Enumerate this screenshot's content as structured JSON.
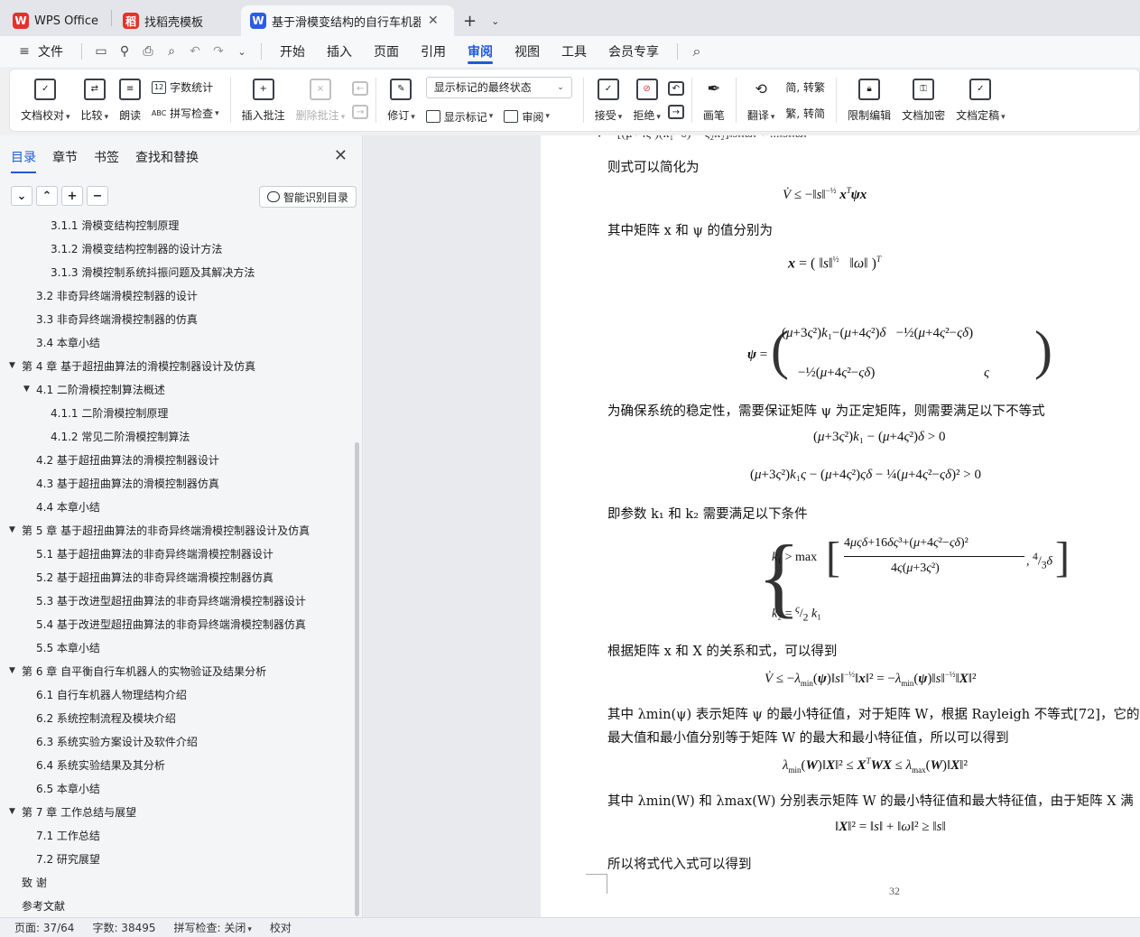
{
  "tabs": [
    {
      "label": "WPS Office",
      "logo": "W",
      "color": "#e5322d",
      "active": false
    },
    {
      "label": "找稻壳模板",
      "logo": "稻",
      "color": "#e5322d",
      "active": false
    },
    {
      "label": "基于滑模变结构的自行车机器人",
      "logo": "W",
      "color": "#2b5ce6",
      "active": true
    }
  ],
  "menu": {
    "file": "文件",
    "items": [
      "开始",
      "插入",
      "页面",
      "引用",
      "审阅",
      "视图",
      "工具",
      "会员专享"
    ],
    "active": "审阅"
  },
  "ribbon": {
    "doc_check": "文档校对",
    "compare": "比较",
    "read_aloud": "朗读",
    "word_count": "字数统计",
    "spell_check": "拼写检查",
    "insert_comment": "插入批注",
    "delete_comment": "删除批注",
    "revise": "修订",
    "markup_state": "显示标记的最终状态",
    "show_markup": "显示标记",
    "review": "审阅",
    "accept": "接受",
    "reject": "拒绝",
    "pen": "画笔",
    "translate": "翻译",
    "to_traditional": "简, 转繁",
    "to_simplified": "繁, 转简",
    "restrict_edit": "限制编辑",
    "encrypt": "文档加密",
    "finalize": "文档定稿"
  },
  "nav": {
    "tabs": [
      "目录",
      "章节",
      "书签",
      "查找和替换"
    ],
    "smart_toc": "智能识别目录",
    "toc": [
      {
        "text": "3.1.1 滑模变结构控制原理",
        "level": 3,
        "arrow": ""
      },
      {
        "text": "3.1.2  滑模变结构控制器的设计方法",
        "level": 3,
        "arrow": ""
      },
      {
        "text": "3.1.3 滑模控制系统抖振问题及其解决方法",
        "level": 3,
        "arrow": ""
      },
      {
        "text": "3.2  非奇异终端滑模控制器的设计",
        "level": 2,
        "arrow": ""
      },
      {
        "text": "3.3  非奇异终端滑模控制器的仿真",
        "level": 2,
        "arrow": ""
      },
      {
        "text": "3.4  本章小结",
        "level": 2,
        "arrow": ""
      },
      {
        "text": "第 4 章  基于超扭曲算法的滑模控制器设计及仿真",
        "level": 1,
        "arrow": "▼"
      },
      {
        "text": "4.1  二阶滑模控制算法概述",
        "level": 2,
        "arrow": "▼"
      },
      {
        "text": "4.1.1  二阶滑模控制原理",
        "level": 3,
        "arrow": ""
      },
      {
        "text": "4.1.2  常见二阶滑模控制算法",
        "level": 3,
        "arrow": ""
      },
      {
        "text": "4.2  基于超扭曲算法的滑模控制器设计",
        "level": 2,
        "arrow": ""
      },
      {
        "text": "4.3  基于超扭曲算法的滑模控制器仿真",
        "level": 2,
        "arrow": ""
      },
      {
        "text": "4.4  本章小结",
        "level": 2,
        "arrow": ""
      },
      {
        "text": "第 5 章  基于超扭曲算法的非奇异终端滑模控制器设计及仿真",
        "level": 1,
        "arrow": "▼"
      },
      {
        "text": "5.1  基于超扭曲算法的非奇异终端滑模控制器设计",
        "level": 2,
        "arrow": ""
      },
      {
        "text": "5.2  基于超扭曲算法的非奇异终端滑模控制器仿真",
        "level": 2,
        "arrow": ""
      },
      {
        "text": "5.3  基于改进型超扭曲算法的非奇异终端滑模控制器设计",
        "level": 2,
        "arrow": ""
      },
      {
        "text": "5.4  基于改进型超扭曲算法的非奇异终端滑模控制器仿真",
        "level": 2,
        "arrow": ""
      },
      {
        "text": "5.5  本章小结",
        "level": 2,
        "arrow": ""
      },
      {
        "text": "第 6 章  自平衡自行车机器人的实物验证及结果分析",
        "level": 1,
        "arrow": "▼"
      },
      {
        "text": "6.1  自行车机器人物理结构介绍",
        "level": 2,
        "arrow": ""
      },
      {
        "text": "6.2  系统控制流程及模块介绍",
        "level": 2,
        "arrow": ""
      },
      {
        "text": "6.3  系统实验方案设计及软件介绍",
        "level": 2,
        "arrow": ""
      },
      {
        "text": "6.4  系统实验结果及其分析",
        "level": 2,
        "arrow": ""
      },
      {
        "text": "6.5  本章小结",
        "level": 2,
        "arrow": ""
      },
      {
        "text": "第 7 章  工作总结与展望",
        "level": 1,
        "arrow": "▼"
      },
      {
        "text": "7.1  工作总结",
        "level": 2,
        "arrow": ""
      },
      {
        "text": "7.2  研究展望",
        "level": 2,
        "arrow": ""
      },
      {
        "text": "致    谢",
        "level": 1,
        "arrow": ""
      },
      {
        "text": "参考文献",
        "level": 1,
        "arrow": ""
      }
    ]
  },
  "doc": {
    "p1": "则式可以简化为",
    "p2": "其中矩阵 x 和 ψ 的值分别为",
    "p3": "为确保系统的稳定性，需要保证矩阵 ψ 为正定矩阵，则需要满足以下不等式",
    "p4": "即参数 k₁ 和 k₂ 需要满足以下条件",
    "p5": "根据矩阵 x 和 X 的关系和式，可以得到",
    "p6": "其中 λmin(ψ) 表示矩阵 ψ 的最小特征值，对于矩阵 W，根据 Rayleigh 不等式[72]，它的",
    "p7": "最大值和最小值分别等于矩阵 W 的最大和最小特征值，所以可以得到",
    "p8": "其中 λmin(W) 和 λmax(W) 分别表示矩阵 W 的最小特征值和最大特征值，由于矩阵 X 满",
    "p9": "所以将式代入式可以得到",
    "page_number": "32"
  },
  "status": {
    "page": "页面: 37/64",
    "words": "字数: 38495",
    "spell": "拼写检查: 关闭",
    "proof": "校对"
  }
}
